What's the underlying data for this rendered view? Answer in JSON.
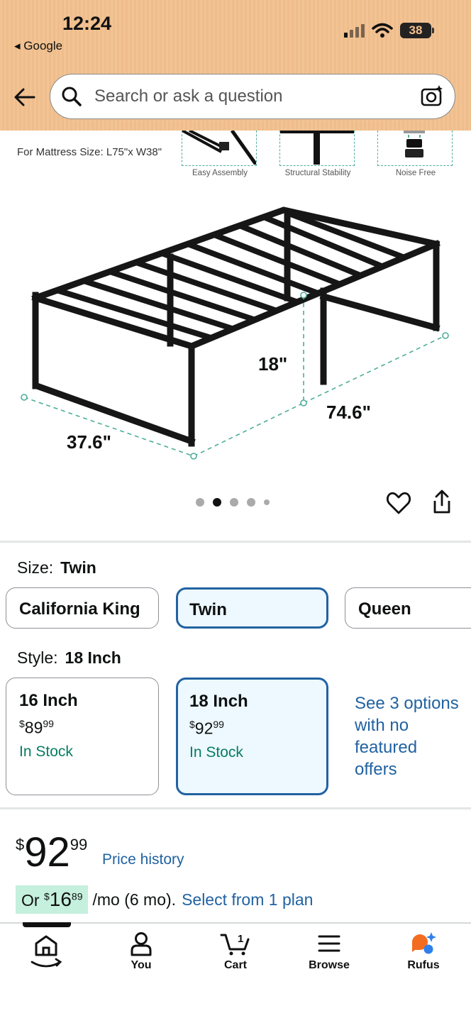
{
  "status_bar": {
    "time": "12:24",
    "back_app": "Google",
    "battery": "38"
  },
  "search": {
    "placeholder": "Search or ask a question"
  },
  "product_image": {
    "mattress_size": "For Mattress Size: L75\"x W38\"",
    "features": [
      "Easy Assembly",
      "Structural Stability",
      "Noise Free"
    ],
    "dim_height": "18\"",
    "dim_length": "74.6\"",
    "dim_width": "37.6\"",
    "carousel_total": 5,
    "carousel_active": 2
  },
  "size": {
    "label": "Size:",
    "value": "Twin",
    "options": [
      "California King",
      "Twin",
      "Queen"
    ]
  },
  "style": {
    "label": "Style:",
    "value": "18 Inch",
    "options": [
      {
        "name": "16 Inch",
        "currency": "$",
        "dollars": "89",
        "cents": "99",
        "stock": "In Stock"
      },
      {
        "name": "18 Inch",
        "currency": "$",
        "dollars": "92",
        "cents": "99",
        "stock": "In Stock"
      }
    ],
    "more": "See 3 options with no featured offers"
  },
  "price": {
    "currency": "$",
    "dollars": "92",
    "cents": "99",
    "history": "Price history",
    "monthly_prefix": "Or",
    "monthly_currency": "$",
    "monthly_dollars": "16",
    "monthly_cents": "89",
    "monthly_suffix": "/mo (6 mo).",
    "plan_link": "Select from 1 plan"
  },
  "nav": {
    "items": [
      "You",
      "Cart",
      "Browse",
      "Rufus"
    ],
    "cart_count": "1"
  },
  "colors": {
    "link": "#2162a1",
    "selected_border": "#2162a1",
    "stock": "#067d62",
    "header": "#f2c394"
  }
}
